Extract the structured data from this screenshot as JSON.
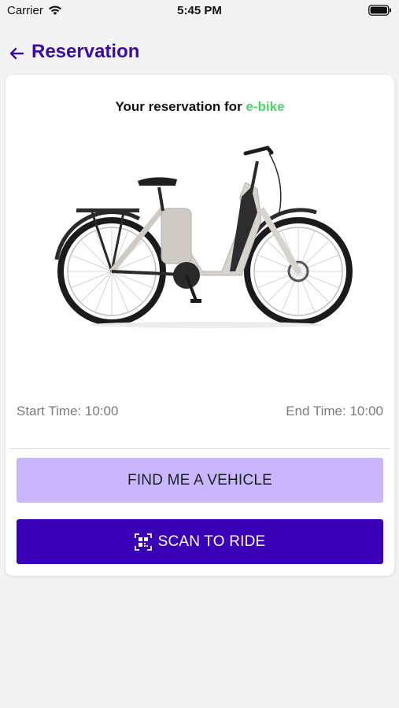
{
  "status_bar": {
    "carrier": "Carrier",
    "time": "5:45 PM",
    "wifi_icon": "wifi-icon",
    "battery_icon": "battery-icon"
  },
  "header": {
    "back_icon": "arrow-left-icon",
    "title": "Reservation"
  },
  "card": {
    "heading_prefix": "Your reservation for ",
    "vehicle_type": "e-bike",
    "image_icon": "e-bike-image",
    "start_time": "Start Time: 10:00",
    "end_time": "End Time: 10:00"
  },
  "actions": {
    "find_label": "FIND ME A VEHICLE",
    "scan_label": "SCAN TO RIDE",
    "scan_icon": "qr-code-icon"
  },
  "colors": {
    "title": "#3a0ca3",
    "accent_green": "#4fd16b",
    "find_button_bg": "#c9b6ff",
    "scan_button_bg": "#3a00b8",
    "background": "#f3f3f3"
  }
}
